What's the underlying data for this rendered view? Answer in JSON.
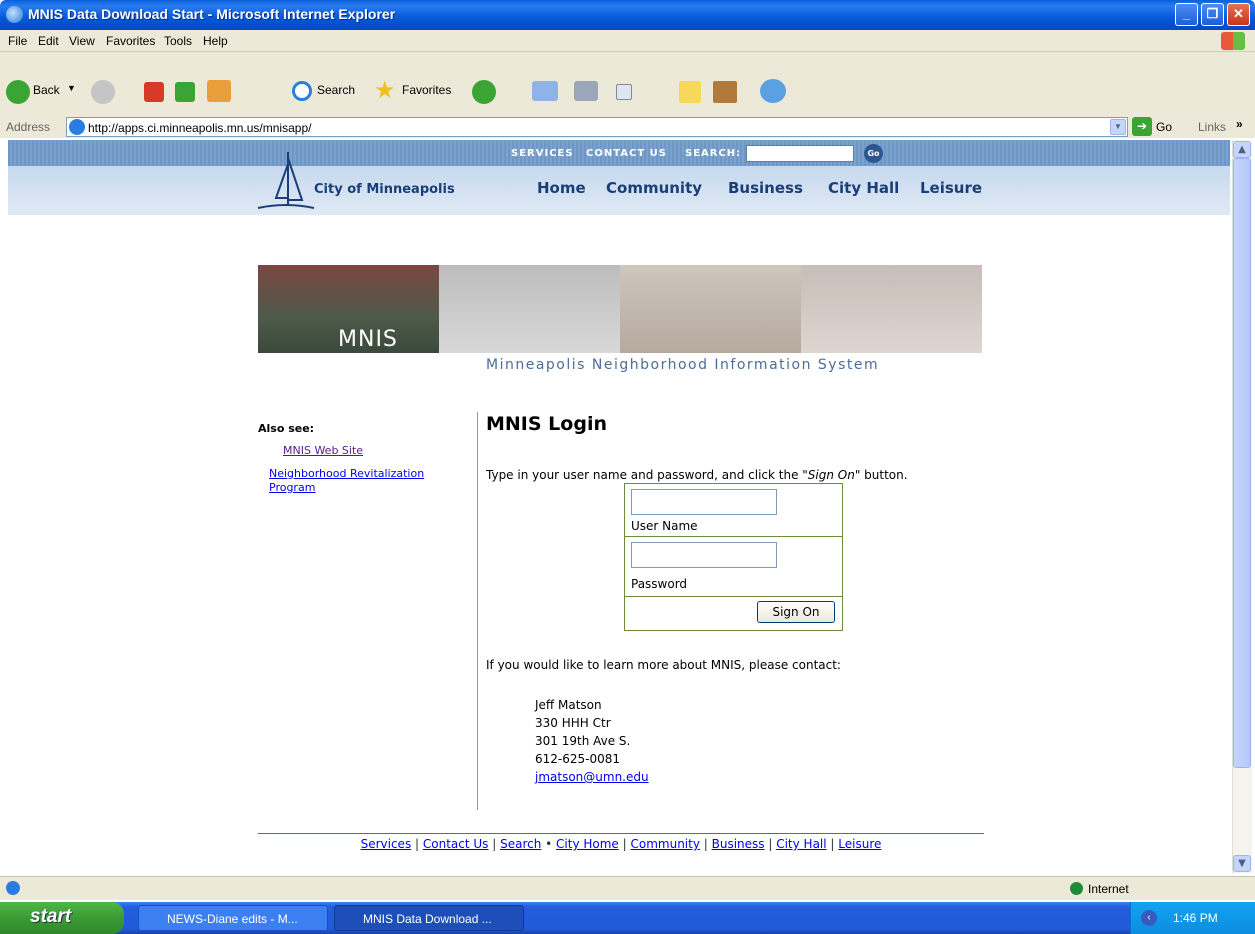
{
  "window": {
    "title": "MNIS Data Download Start - Microsoft Internet Explorer"
  },
  "menu": [
    "File",
    "Edit",
    "View",
    "Favorites",
    "Tools",
    "Help"
  ],
  "toolbar": {
    "back": "Back",
    "search": "Search",
    "favorites": "Favorites"
  },
  "address": {
    "label": "Address",
    "url": "http://apps.ci.minneapolis.mn.us/mnisapp/",
    "go": "Go",
    "links": "Links"
  },
  "site": {
    "top_links": [
      "SERVICES",
      "CONTACT US",
      "SEARCH:"
    ],
    "go_label": "Go",
    "city_name": "City of Minneapolis",
    "nav": [
      "Home",
      "Community",
      "Business",
      "City Hall",
      "Leisure"
    ]
  },
  "banner": {
    "word": "MNIS",
    "subtitle": "Minneapolis Neighborhood Information System"
  },
  "sidebar": {
    "heading": "Also see:",
    "links": [
      "MNIS Web Site",
      "Neighborhood Revitalization",
      "Program"
    ]
  },
  "main": {
    "title": "MNIS Login",
    "instruction_pre": "Type in your user name and password, and click the \"",
    "instruction_em": "Sign On",
    "instruction_post": "\" button.",
    "username_label": "User Name",
    "password_label": "Password",
    "signon_label": "Sign On",
    "learn_more": "If you would like to learn more about MNIS, please contact:",
    "contact": {
      "name": "Jeff Matson",
      "line1": "330 HHH Ctr",
      "line2": "301 19th Ave S.",
      "phone": "612-625-0081",
      "email": "jmatson@umn.edu"
    }
  },
  "footer": {
    "links": [
      "Services",
      "Contact Us",
      "Search",
      "City Home",
      "Community",
      "Business",
      "City Hall",
      "Leisure"
    ]
  },
  "status": {
    "zone": "Internet"
  },
  "taskbar": {
    "start": "start",
    "tasks": [
      "NEWS-Diane edits - M...",
      "MNIS Data Download ..."
    ],
    "clock": "1:46 PM"
  }
}
